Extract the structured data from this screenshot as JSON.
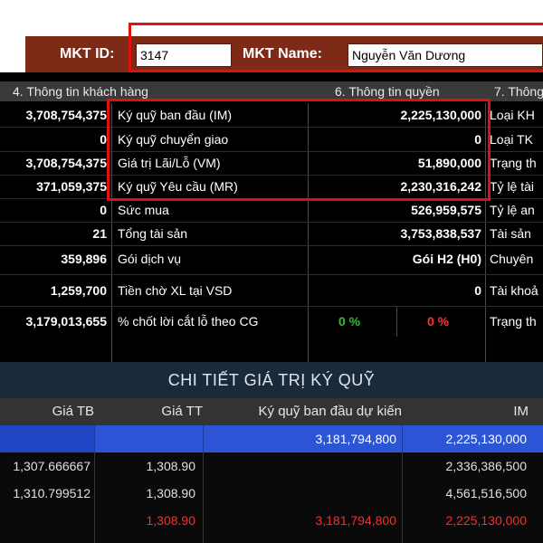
{
  "header": {
    "mkt_id_label": "MKT ID:",
    "mkt_id_value": "3147",
    "mkt_name_label": "MKT Name:",
    "mkt_name_value": "Nguyễn Văn Dương"
  },
  "sections": {
    "s4": "4. Thông tin khách hàng",
    "s6": "6. Thông tin quyền",
    "s7": "7. Thông"
  },
  "left_values": [
    "3,708,754,375",
    "0",
    "3,708,754,375",
    "371,059,375",
    "0",
    "21",
    "359,896",
    "1,259,700",
    "3,179,013,655"
  ],
  "rows": [
    {
      "label": "Ký quỹ ban đầu (IM)",
      "value": "2,225,130,000",
      "right": "Loại KH"
    },
    {
      "label": "Ký quỹ chuyển giao",
      "value": "0",
      "right": "Loại TK"
    },
    {
      "label": "Giá trị Lãi/Lỗ (VM)",
      "value": "51,890,000",
      "right": "Trạng th"
    },
    {
      "label": "Ký quỹ Yêu cầu (MR)",
      "value": "2,230,316,242",
      "right": "Tỷ lệ tài"
    },
    {
      "label": "Sức mua",
      "value": "526,959,575",
      "right": "Tỷ lệ an"
    },
    {
      "label": "Tổng tài sản",
      "value": "3,753,838,537",
      "right": "Tài sản"
    },
    {
      "label": "Gói dịch vụ",
      "value": "Gói H2 (H0)",
      "right": "Chuyên"
    },
    {
      "label": "Tiền chờ XL tại VSD",
      "value": "0",
      "right": "Tài khoả"
    },
    {
      "label": "% chốt lời cắt lỗ theo CG",
      "value_green": "0 %",
      "value_red": "0 %",
      "right": "Trạng th"
    }
  ],
  "detail": {
    "title": "CHI TIẾT GIÁ TRỊ KÝ QUỸ",
    "headers": {
      "gia_tb": "Giá TB",
      "gia_tt": "Giá TT",
      "kq_du_kien": "Ký quỹ ban đầu dự kiến",
      "im": "IM"
    },
    "selected_row": {
      "kq_du_kien": "3,181,794,800",
      "im": "2,225,130,000"
    },
    "data_rows": [
      {
        "gia_tb": "1,307.666667",
        "gia_tt": "1,308.90",
        "im": "2,336,386,500"
      },
      {
        "gia_tb": "1,310.799512",
        "gia_tt": "1,308.90",
        "im": "4,561,516,500"
      }
    ],
    "total_row": {
      "gia_tt": "1,308.90",
      "kq_du_kien": "3,181,794,800",
      "im": "2,225,130,000"
    }
  },
  "colors": {
    "accent": "#7d2a16",
    "highlight": "#e01010",
    "selected": "#2c55d6",
    "positive": "#2fbf2f",
    "negative": "#ff3030"
  }
}
